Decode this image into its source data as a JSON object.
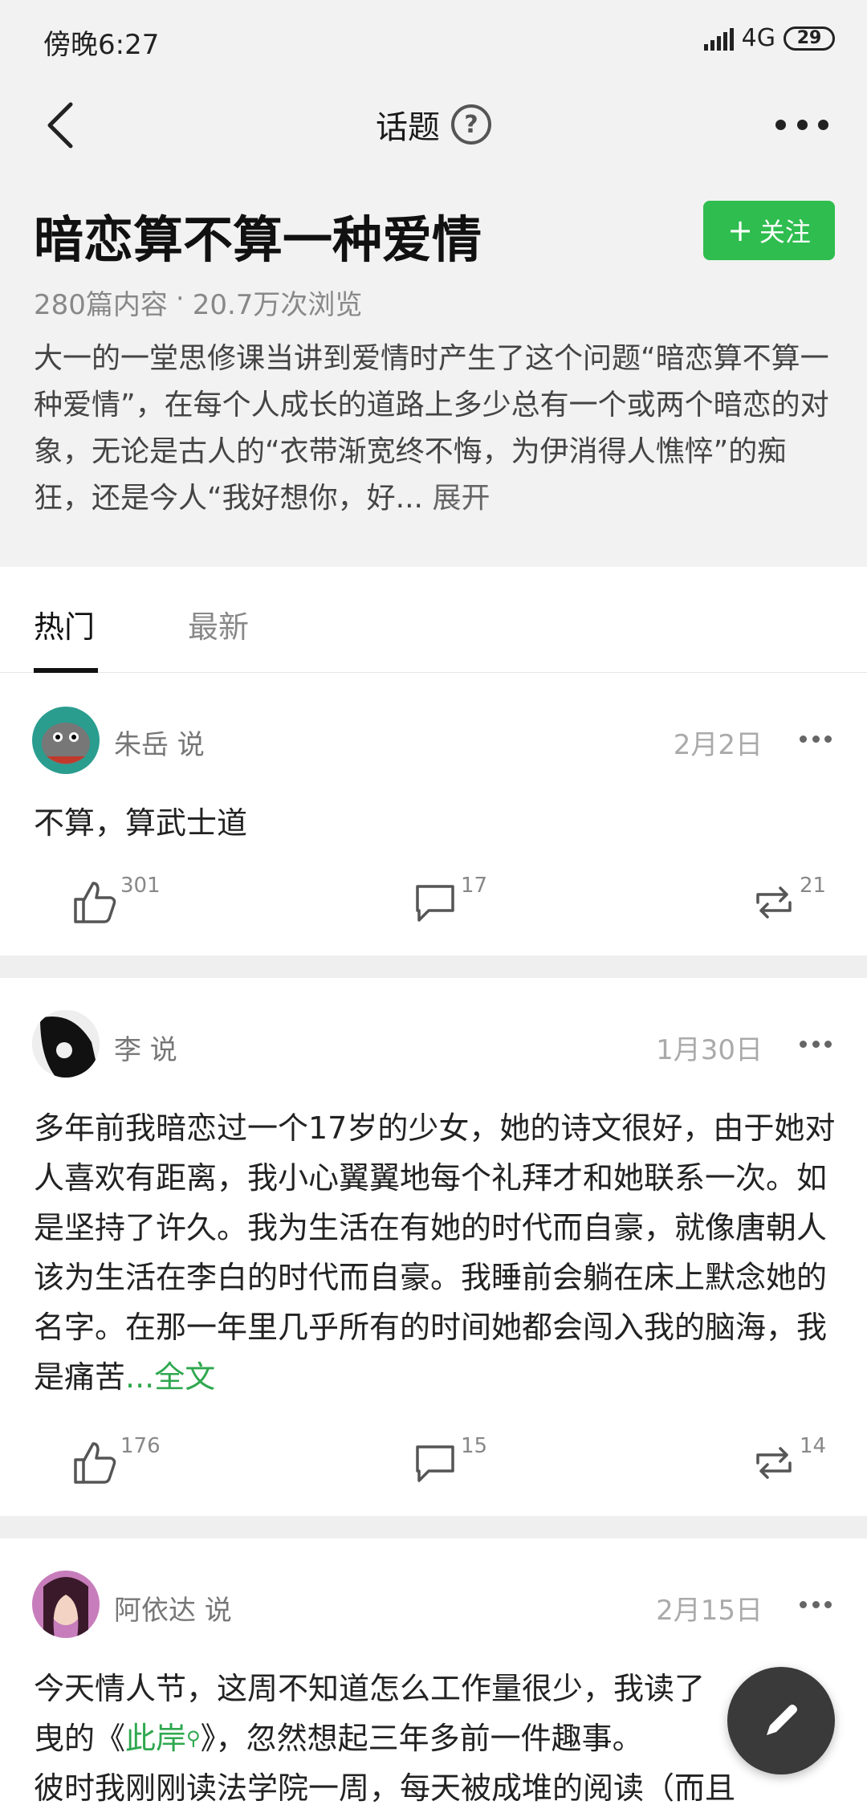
{
  "status": {
    "time": "傍晚6:27",
    "network": "4G",
    "battery": "29"
  },
  "nav": {
    "title": "话题"
  },
  "topic": {
    "title": "暗恋算不算一种爱情",
    "follow_label": "关注",
    "follow_icon": "plus-icon",
    "posts_count": "280篇内容",
    "separator": "·",
    "views": "20.7万次浏览",
    "description": "大一的一堂思修课当讲到爱情时产生了这个问题“暗恋算不算一种爱情”，在每个人成长的道路上多少总有一个或两个暗恋的对象，无论是古人的“衣带渐宽终不悔，为伊消得人憔悴”的痴狂，还是今人“我好想你，好...",
    "expand": "展开"
  },
  "tabs": [
    {
      "label": "热门"
    },
    {
      "label": "最新"
    }
  ],
  "posts": [
    {
      "author": "朱岳 说",
      "date": "2月2日",
      "body": "不算，算武士道",
      "likes": "301",
      "comments": "17",
      "reposts": "21"
    },
    {
      "author": "李 说",
      "date": "1月30日",
      "body": "多年前我暗恋过一个17岁的少女，她的诗文很好，由于她对人喜欢有距离，我小心翼翼地每个礼拜才和她联系一次。如是坚持了许久。我为生活在有她的时代而自豪，就像唐朝人该为生活在李白的时代而自豪。我睡前会躺在床上默念她的名字。在那一年里几乎所有的时间她都会闯入我的脑海，我是痛苦",
      "full_text": "...全文",
      "likes": "176",
      "comments": "15",
      "reposts": "14"
    },
    {
      "author": "阿依达 说",
      "date": "2月15日",
      "body_line1": "今天情人节，这周不知道怎么工作量很少，我读了",
      "body_line2_a": "曳的《",
      "body_line2_link": "此岸",
      "body_line2_b": "》，忽然想起三年多前一件趣事。",
      "body_line3": "彼时我刚刚读法学院一周，每天被成堆的阅读（而且"
    }
  ],
  "colors": {
    "accent_green": "#2fbd4f",
    "link_green": "#2fa84f",
    "header_bg": "#f2f2f2",
    "fab_bg": "#3a3a3a"
  }
}
